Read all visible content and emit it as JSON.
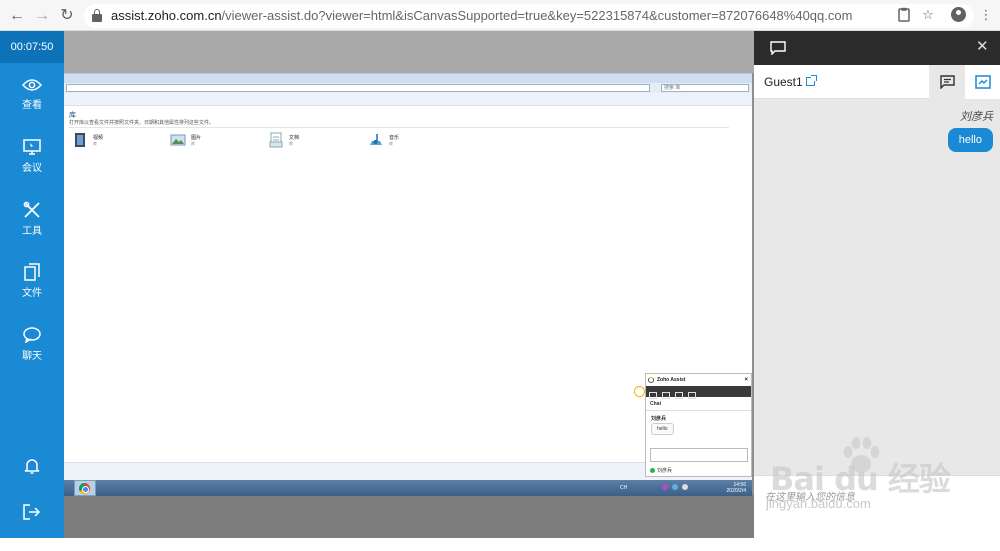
{
  "browser": {
    "url_host": "assist.zoho.com.cn",
    "url_path": "/viewer-assist.do?viewer=html&isCanvasSupported=true&key=522315874&customer=872076648%40qq.com"
  },
  "sidebar": {
    "timer": "00:07:50",
    "items": [
      {
        "label": "查看",
        "icon": "eye-icon"
      },
      {
        "label": "会议",
        "icon": "monitor-icon"
      },
      {
        "label": "工具",
        "icon": "tools-icon"
      },
      {
        "label": "文件",
        "icon": "files-icon"
      },
      {
        "label": "聊天",
        "icon": "chat-bubble-icon"
      }
    ],
    "bottom_icons": [
      "bell-icon",
      "exit-icon"
    ]
  },
  "remote": {
    "search_placeholder": "搜索 库",
    "library_title": "库",
    "library_desc": "打开库以查看文件并按照文件夹、日期和其他属性排列这些文件。",
    "items": [
      {
        "name": "视频",
        "sub": "库"
      },
      {
        "name": "图片",
        "sub": "库"
      },
      {
        "name": "文档",
        "sub": "库"
      },
      {
        "name": "音乐",
        "sub": "库"
      }
    ],
    "tray_time": "14:56",
    "tray_date": "2020/2/4",
    "tray_lang": "CH"
  },
  "mini_widget": {
    "title": "Zoho Assist",
    "section": "Chat",
    "sender": "刘彦兵",
    "message": "hello",
    "footer_user": "刘彦兵"
  },
  "panel": {
    "guest_name": "Guest1",
    "sender": "刘彦兵",
    "message": "hello",
    "input_placeholder": "在这里输入您的信息"
  },
  "watermark": {
    "text": "Bai du 经验",
    "sub": "jingyan.baidu.com"
  },
  "colors": {
    "accent": "#1a8ad4",
    "panel_dark": "#2b2b2b"
  }
}
